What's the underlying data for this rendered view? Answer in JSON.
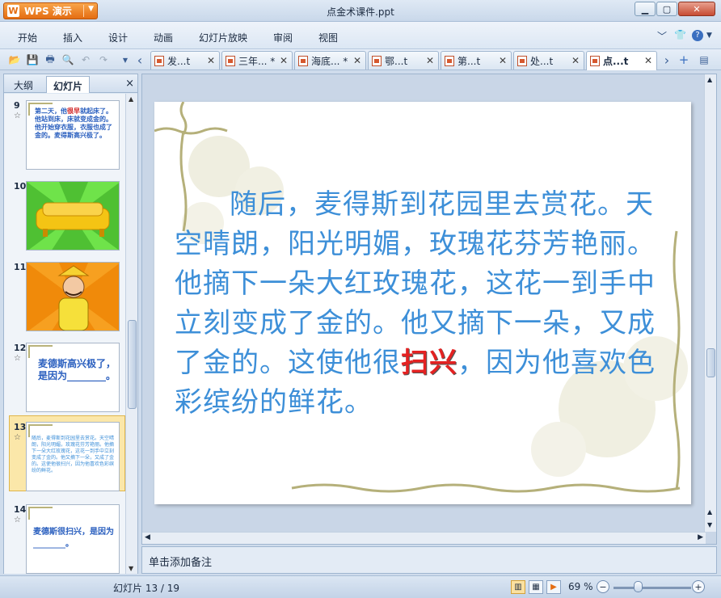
{
  "window": {
    "app_button_label": "WPS 演示",
    "app_logo_letter": "W",
    "title": "点金术课件.ppt"
  },
  "menu": {
    "items": [
      "开始",
      "插入",
      "设计",
      "动画",
      "幻灯片放映",
      "审阅",
      "视图"
    ],
    "help_label": "?"
  },
  "tabs": [
    {
      "label": "发...t"
    },
    {
      "label": "三年... *"
    },
    {
      "label": "海底... *"
    },
    {
      "label": "鄂...t"
    },
    {
      "label": "第...t"
    },
    {
      "label": "处...t"
    },
    {
      "label": "点...t",
      "active": true
    }
  ],
  "left_panel": {
    "tab_outline": "大纲",
    "tab_slides": "幻灯片",
    "close": "×"
  },
  "thumbnails": [
    {
      "number": "9",
      "text_a": "第二天，他",
      "text_b": "很早",
      "text_c": "就起床了。他站到床，床就变成金的。他开始穿衣服，衣服也成了金的。麦得斯高兴极了。"
    },
    {
      "number": "10",
      "image": "sofa-image"
    },
    {
      "number": "11",
      "image": "king-image"
    },
    {
      "number": "12",
      "text": "麦德斯高兴极了，是因为________。"
    },
    {
      "number": "13",
      "text": "随后，麦得斯到花园里去赏花。天空晴朗，阳光明媚，玫瑰花芬芳艳丽。他摘下一朵大红玫瑰花，这花一到手中立刻变成了金的。他又摘下一朵，又成了金的。这使他很扫兴，因为他喜欢色彩缤纷的鲜花。",
      "red": "扫兴",
      "selected": true
    },
    {
      "number": "14",
      "text": "麦德斯很扫兴，是因为________。"
    }
  ],
  "slide": {
    "text_before": "随后，麦得斯到花园里去赏花。天空晴朗，阳光明媚，玫瑰花芬芳艳丽。他摘下一朵大红玫瑰花，这花一到手中立刻变成了金的。他又摘下一朵，又成了金的。这使他很",
    "text_red": "扫兴",
    "text_after": "，因为他喜欢色彩缤纷的鲜花。"
  },
  "notes_placeholder": "单击添加备注",
  "status": {
    "slide_indicator": "幻灯片 13 / 19",
    "zoom": "69 %"
  },
  "colors": {
    "slide_text": "#3d8fd8",
    "highlight": "#e42222",
    "accent_orange": "#e46d12"
  }
}
